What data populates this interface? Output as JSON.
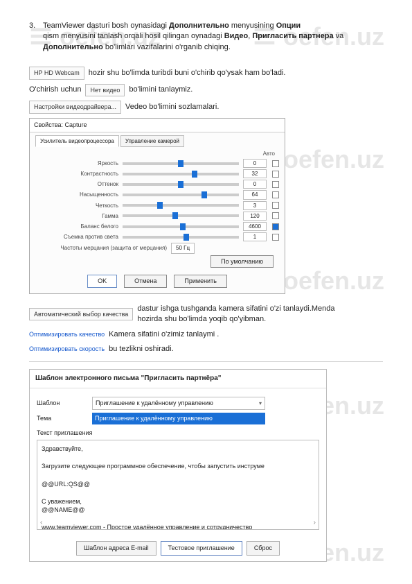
{
  "watermark": "oefen.uz",
  "item3": {
    "num": "3.",
    "text_before_bold1": "TeamViewer dasturi bosh oynasidagi ",
    "bold1": "Дополнительно",
    "text_mid1": " menyusining ",
    "bold2": "Опции",
    "text_line2a": "qism menyusini tanlash orqali hosil qilingan oynadagi ",
    "bold3": "Видео",
    "comma": ", ",
    "bold4": "Пригласить партнера",
    "text_va": " va ",
    "bold5": "Дополнительно",
    "text_end": " bo'limlari vazifalarini o'rganib chiqing."
  },
  "webcam_box": "HP HD Webcam",
  "webcam_text": " hozir shu bo'limda turibdi buni o'chirib qo'ysak ham bo'ladi.",
  "ochirishUchun": "O'chirish uchun ",
  "netVideo": "Нет видео",
  "bolimini": " bo'limini tanlaymiz.",
  "videoSettingsBtn": "Настройки видеодрайвера...",
  "videoSettingsText": " Vedeo bo'limini sozlamalari.",
  "dialog": {
    "title": "Свойства: Capture",
    "tab1": "Усилитель видеопроцессора",
    "tab2": "Управление камерой",
    "autoLabel": "Авто",
    "sliders": [
      {
        "label": "Яркость",
        "val": "0",
        "pos": 50,
        "auto": false
      },
      {
        "label": "Контрастность",
        "val": "32",
        "pos": 62,
        "auto": false
      },
      {
        "label": "Оттенок",
        "val": "0",
        "pos": 50,
        "auto": false
      },
      {
        "label": "Насыщенность",
        "val": "64",
        "pos": 70,
        "auto": false
      },
      {
        "label": "Четкость",
        "val": "3",
        "pos": 32,
        "auto": false
      },
      {
        "label": "Гамма",
        "val": "120",
        "pos": 45,
        "auto": false
      },
      {
        "label": "Баланс белого",
        "val": "4600",
        "pos": 52,
        "auto": true
      },
      {
        "label": "Съемка против света",
        "val": "1",
        "pos": 55,
        "auto": false
      }
    ],
    "freqLabel": "Частоты мерцания (защита от мерцания)",
    "freqVal": "50 Гц",
    "defaultBtn": "По умолчанию",
    "ok": "OK",
    "cancel": "Отмена",
    "apply": "Применить"
  },
  "autoQualityBox": "Автоматический выбор качества",
  "autoQualityText": " dastur ishga tushganda kamera sifatini o'zi tanlaydi.Menda hozirda shu bo'limda yoqib qo'yibman.",
  "optQualityLink": "Оптимизировать качество",
  "optQualityText": " Kamera sifatini o'zimiz tanlaymi .",
  "optSpeedLink": "Оптимизировать скорость",
  "optSpeedText": " bu tezlikni oshiradi.",
  "email": {
    "title": "Шаблон электронного письма \"Пригласить партнёра\"",
    "templateLabel": "Шаблон",
    "templateValue": "Приглашение к удалённому управлению",
    "subjectLabel": "Тема",
    "subjectValue": "Приглашение к удалённому управлению",
    "bodyLabel": "Текст приглашения",
    "bodyLine1": "Здравствуйте,",
    "bodyLine2": "Загрузите следующее программное обеспечение, чтобы запустить инструме",
    "bodyLine3": "@@URL:QS@@",
    "bodyLine4": "С уважением,",
    "bodyLine5": "@@NAME@@",
    "bodyLine6": "www.teamviewer.com - Простое удалённое управление и сотрудничество",
    "btn1": "Шаблон адреса E-mail",
    "btn2": "Тестовое приглашение",
    "btn3": "Сброс"
  }
}
